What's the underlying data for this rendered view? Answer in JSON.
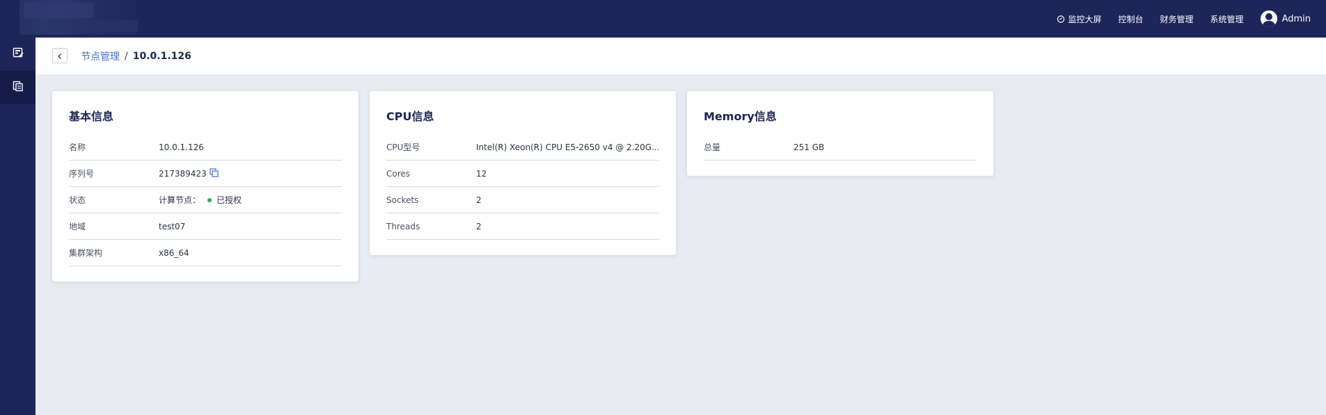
{
  "header": {
    "nav": [
      {
        "label": "监控大屏",
        "icon": "monitor-icon"
      },
      {
        "label": "控制台"
      },
      {
        "label": "财务管理"
      },
      {
        "label": "系统管理"
      }
    ],
    "user": {
      "name": "Admin",
      "icon": "user-avatar-icon"
    }
  },
  "sidebar": {
    "items": [
      {
        "icon": "dashboard-edit-icon",
        "active": false
      },
      {
        "icon": "document-copy-icon",
        "active": true
      }
    ]
  },
  "breadcrumb": {
    "parent": "节点管理",
    "separator": "/",
    "current": "10.0.1.126"
  },
  "basic": {
    "title": "基本信息",
    "rows": [
      {
        "label": "名称",
        "value": "10.0.1.126"
      },
      {
        "label": "序列号",
        "value": "217389423"
      },
      {
        "label": "状态",
        "prefix": "计算节点：",
        "value": "已授权",
        "status_color": "#25b24a"
      },
      {
        "label": "地域",
        "value": "test07"
      },
      {
        "label": "集群架构",
        "value": "x86_64"
      }
    ]
  },
  "cpu": {
    "title": "CPU信息",
    "rows": [
      {
        "label": "CPU型号",
        "value": "Intel(R) Xeon(R) CPU E5-2650 v4 @ 2.20G..."
      },
      {
        "label": "Cores",
        "value": "12"
      },
      {
        "label": "Sockets",
        "value": "2"
      },
      {
        "label": "Threads",
        "value": "2"
      }
    ]
  },
  "memory": {
    "title": "Memory信息",
    "rows": [
      {
        "label": "总量",
        "value": "251 GB"
      }
    ]
  },
  "colors": {
    "header_bg": "#1d2559",
    "page_bg": "#e9ebf3",
    "link": "#3b6fe0",
    "status_ok": "#25b24a"
  }
}
